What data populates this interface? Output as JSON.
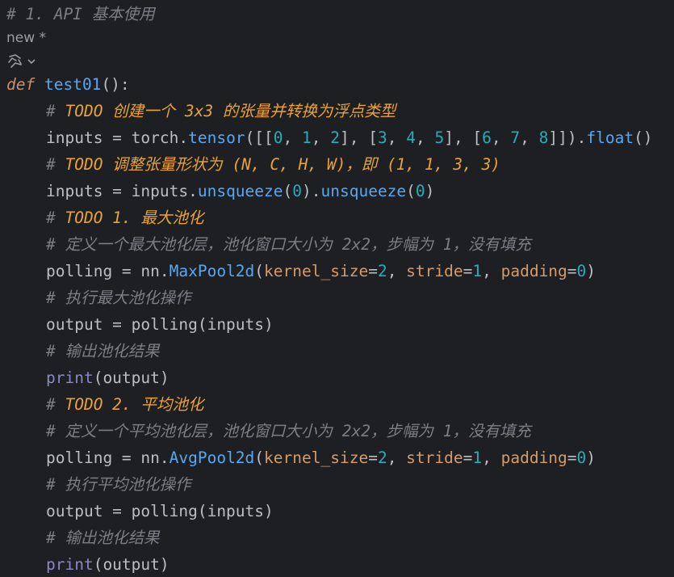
{
  "colors": {
    "background": "#1e1f22",
    "text": "#bcbec4",
    "comment": "#7a7e85",
    "todo": "#e8a23a",
    "keyword": "#cf8e6d",
    "function": "#56a8f5",
    "number": "#2aacb8",
    "param": "#d49c6a",
    "builtin": "#8888c6"
  },
  "header_comment": "# 1. API 基本使用",
  "notebook": {
    "cell_label": "new *",
    "hint_icon": "ai-assistant-icon"
  },
  "code": {
    "def_keyword": "def",
    "func_name": "test01",
    "func_tail": "():",
    "c1_hash": "# ",
    "c1_todo": "TODO 创建一个 3x3 的张量并转换为浮点类型",
    "l_inputs_a": "inputs = torch.",
    "l_inputs_tensor": "tensor",
    "l_inputs_b": "([[",
    "n0": "0",
    "n1": "1",
    "n2": "2",
    "n3": "3",
    "n4": "4",
    "n5": "5",
    "n6": "6",
    "n7": "7",
    "n8": "8",
    "comma": ", ",
    "sep1": "], [",
    "end_list": "]]).",
    "float_m": "float",
    "paren_close": "()",
    "c2_hash": "# ",
    "c2_todo": "TODO 调整张量形状为 (N, C, H, W)，即 (1, 1, 3, 3)",
    "l_unsq_a": "inputs = inputs.",
    "unsqueeze": "unsqueeze",
    "open_p": "(",
    "zero": "0",
    "close_dot": ").",
    "close_p": ")",
    "c3_hash": "# ",
    "c3_todo": "TODO 1. 最大池化",
    "c4": "# 定义一个最大池化层，池化窗口大小为 2x2，步幅为 1，没有填充",
    "l_pool_a": "polling = nn.",
    "maxpool": "MaxPool2d",
    "kernel_kw": "kernel_size",
    "eq": "=",
    "two": "2",
    "stride_kw": "stride",
    "one": "1",
    "padding_kw": "padding",
    "c5": "# 执行最大池化操作",
    "l_output": "output = polling(inputs)",
    "c6": "# 输出池化结果",
    "print_fn": "print",
    "print_arg": "(output)",
    "c7_hash": "# ",
    "c7_todo": "TODO 2. 平均池化",
    "c8": "# 定义一个平均池化层，池化窗口大小为 2x2，步幅为 1，没有填充",
    "avgpool": "AvgPool2d",
    "c9": "# 执行平均池化操作",
    "c10": "# 输出池化结果"
  }
}
